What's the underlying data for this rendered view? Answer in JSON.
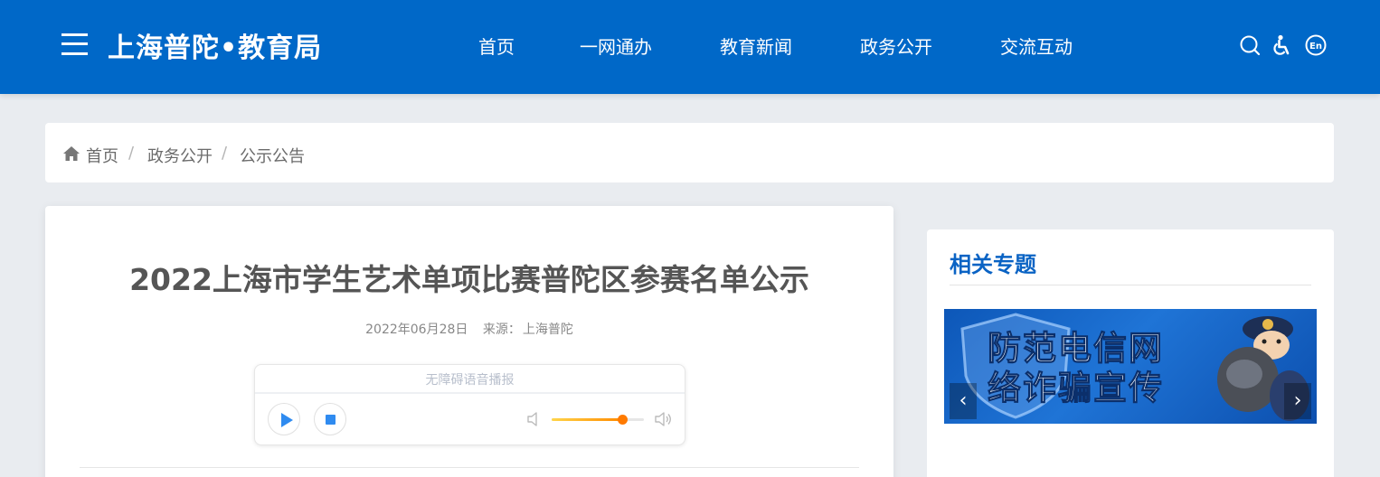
{
  "header": {
    "site_title": "上海普陀•教育局",
    "nav": [
      "首页",
      "一网通办",
      "教育新闻",
      "政务公开",
      "交流互动"
    ],
    "tools": [
      "search-icon",
      "accessibility-icon",
      "english-icon"
    ],
    "en_label": "En",
    "background_color": "#0068c8"
  },
  "breadcrumb": {
    "items": [
      "首页",
      "政务公开",
      "公示公告"
    ],
    "separator": "/"
  },
  "article": {
    "title": "2022上海市学生艺术单项比赛普陀区参赛名单公示",
    "date": "2022年06月28日",
    "source_label": "来源：",
    "source": "上海普陀"
  },
  "player": {
    "label": "无障碍语音播报",
    "volume_percent": 76,
    "accent_color": "#2f8bf0"
  },
  "sidebar": {
    "title": "相关专题",
    "banner": {
      "line1": "防范电信网",
      "line2": "络诈骗宣传",
      "prev_label": "‹",
      "next_label": "›"
    }
  }
}
